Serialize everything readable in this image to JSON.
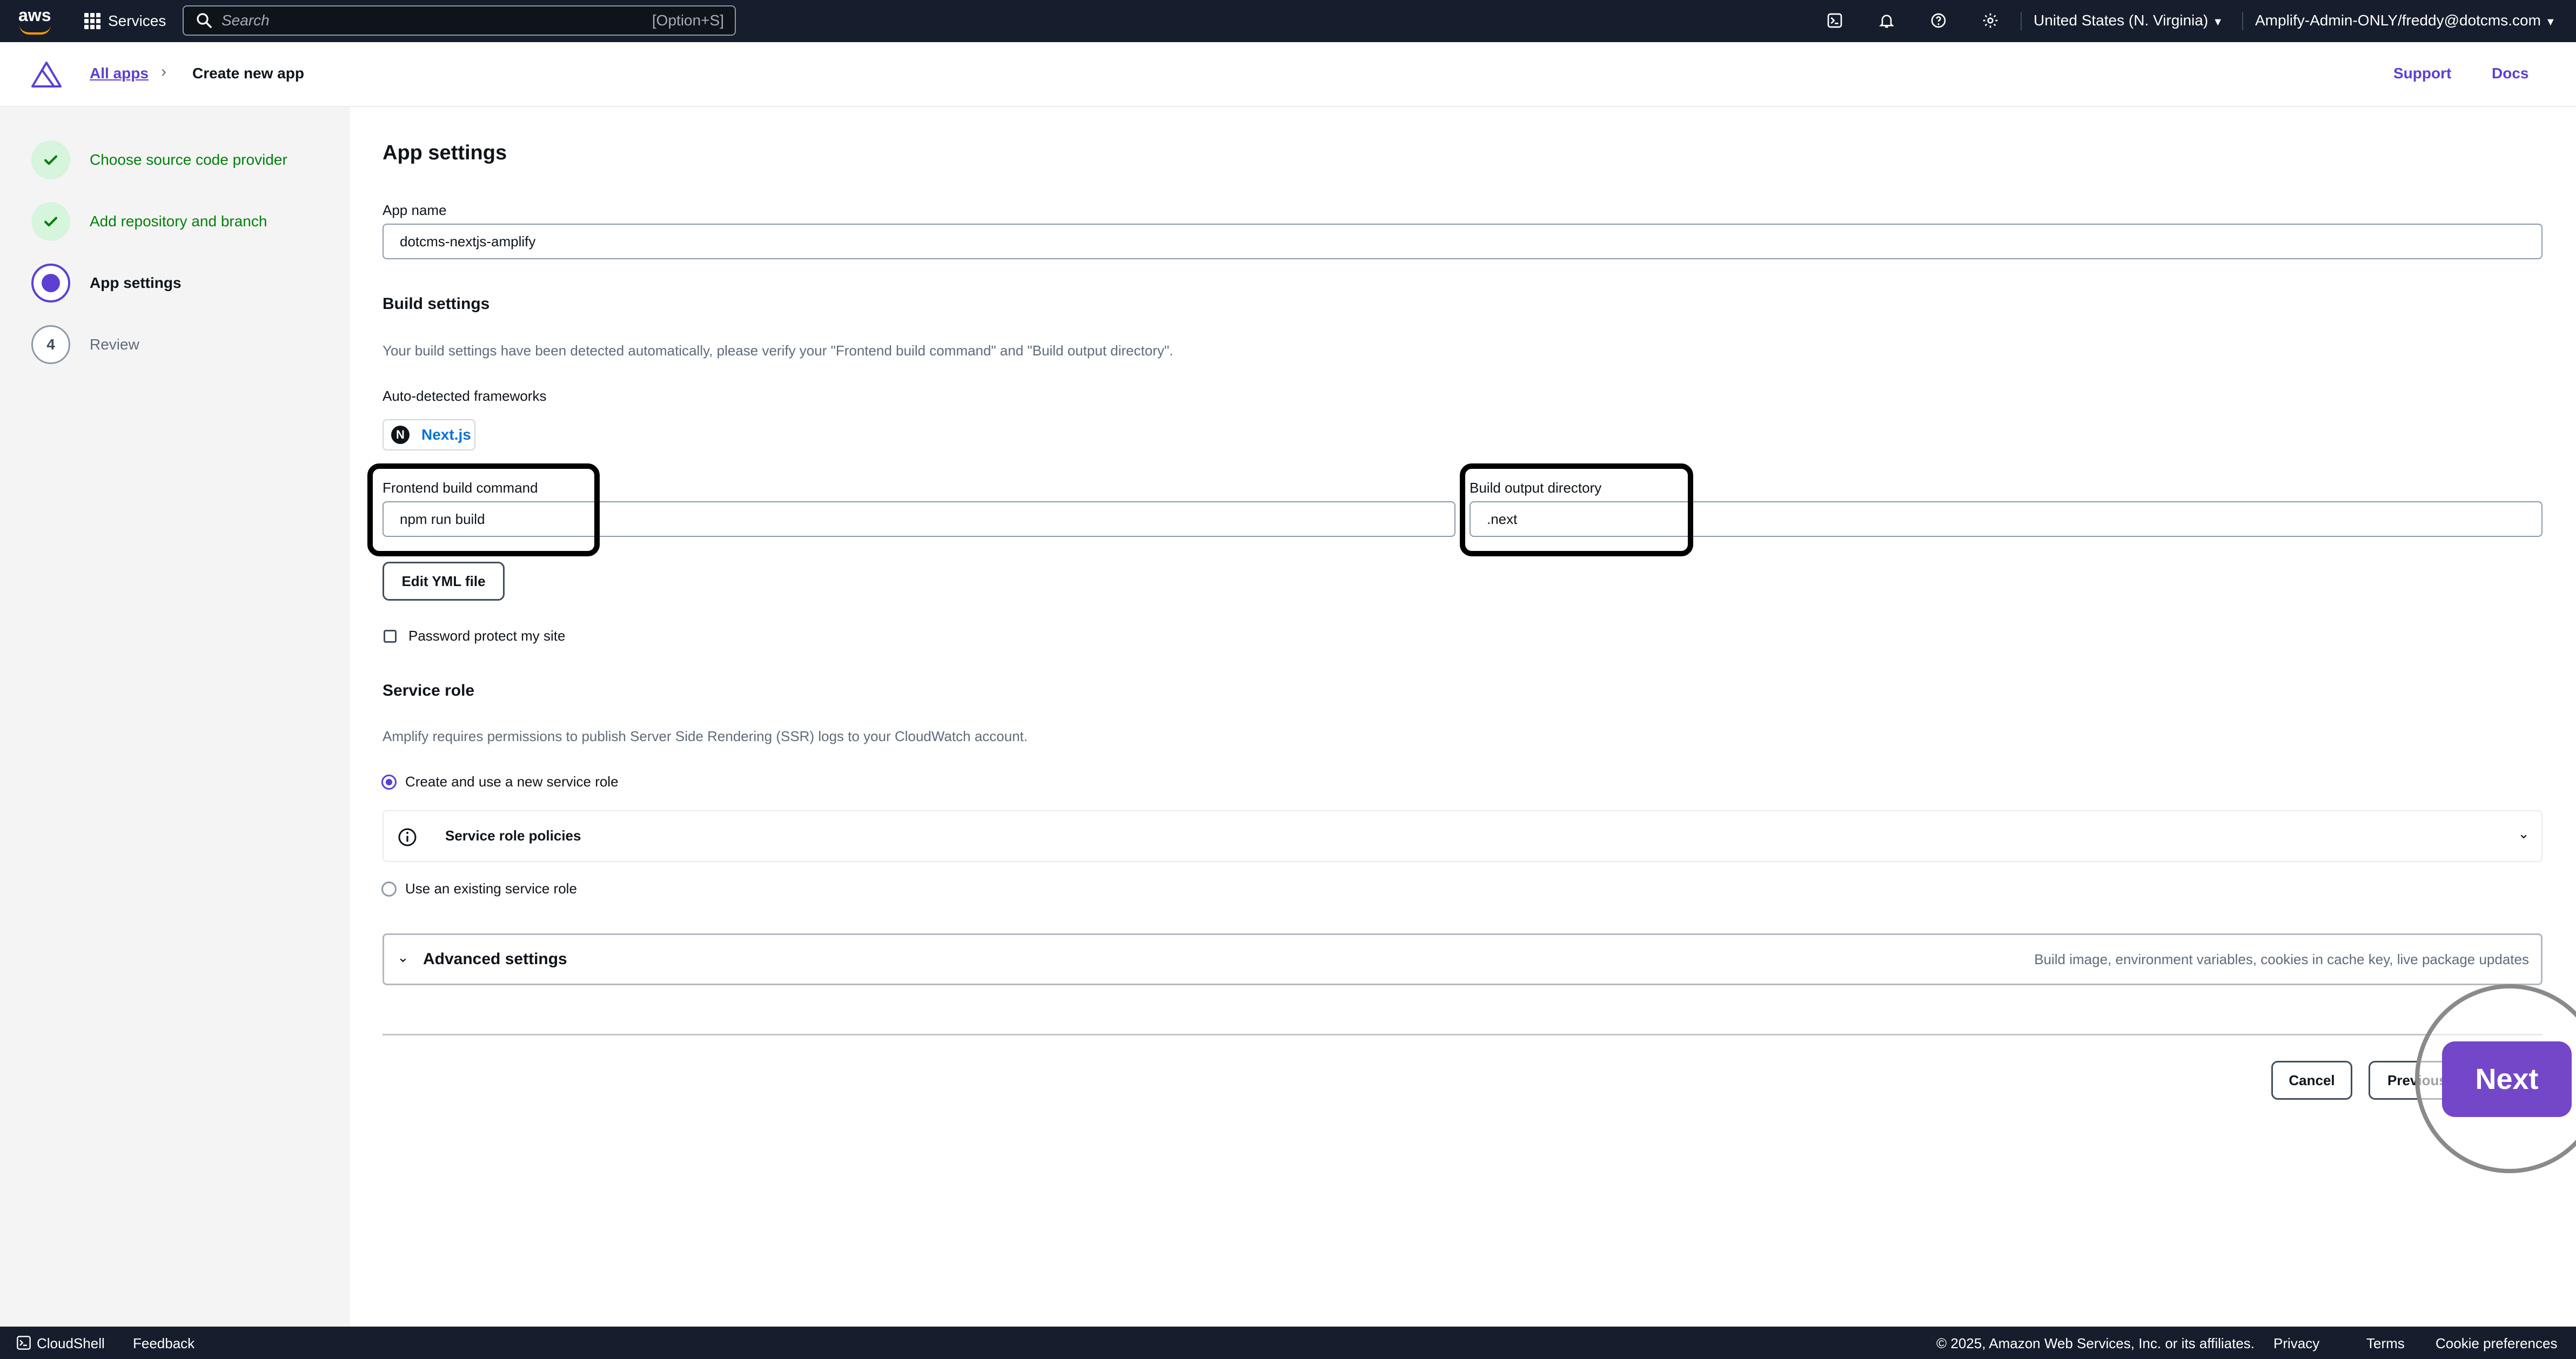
{
  "topbar": {
    "logo_text": "aws",
    "services_label": "Services",
    "search_placeholder": "Search",
    "search_shortcut": "[Option+S]",
    "icons": [
      "cloudshell-icon",
      "bell-icon",
      "help-icon",
      "gear-icon"
    ],
    "region": "United States (N. Virginia)",
    "account": "Amplify-Admin-ONLY/freddy@dotcms.com"
  },
  "header": {
    "breadcrumb_link": "All apps",
    "breadcrumb_current": "Create new app",
    "support": "Support",
    "docs": "Docs"
  },
  "wizard": {
    "steps": [
      {
        "label": "Choose source code provider",
        "state": "done"
      },
      {
        "label": "Add repository and branch",
        "state": "done"
      },
      {
        "label": "App settings",
        "state": "current"
      },
      {
        "label": "Review",
        "state": "todo",
        "number": "4"
      }
    ]
  },
  "main": {
    "title": "App settings",
    "app_name_label": "App name",
    "app_name_value": "dotcms-nextjs-amplify",
    "build_settings_heading": "Build settings",
    "build_settings_desc": "Your build settings have been detected automatically, please verify your \"Frontend build command\" and \"Build output directory\".",
    "frameworks_label": "Auto-detected frameworks",
    "framework_badge_letter": "N",
    "framework_name": "Next.js",
    "frontend_cmd_label": "Frontend build command",
    "frontend_cmd_value": "npm run build",
    "output_dir_label": "Build output directory",
    "output_dir_value": ".next",
    "edit_yml": "Edit YML file",
    "password_protect": "Password protect my site",
    "service_role_heading": "Service role",
    "service_role_desc": "Amplify requires permissions to publish Server Side Rendering (SSR) logs to your CloudWatch account.",
    "create_role_option": "Create and use a new service role",
    "policies_label": "Service role policies",
    "existing_role_option": "Use an existing service role",
    "advanced_label": "Advanced settings",
    "advanced_desc": "Build image, environment variables, cookies in cache key, live package updates",
    "cancel": "Cancel",
    "previous": "Previous",
    "next": "Next"
  },
  "footer": {
    "cloudshell": "CloudShell",
    "feedback": "Feedback",
    "copyright": "© 2025, Amazon Web Services, Inc. or its affiliates.",
    "privacy": "Privacy",
    "terms": "Terms",
    "cookies": "Cookie preferences"
  },
  "colors": {
    "accent": "#5d3fd3",
    "success": "#037f0c",
    "topbar": "#161e2d"
  }
}
